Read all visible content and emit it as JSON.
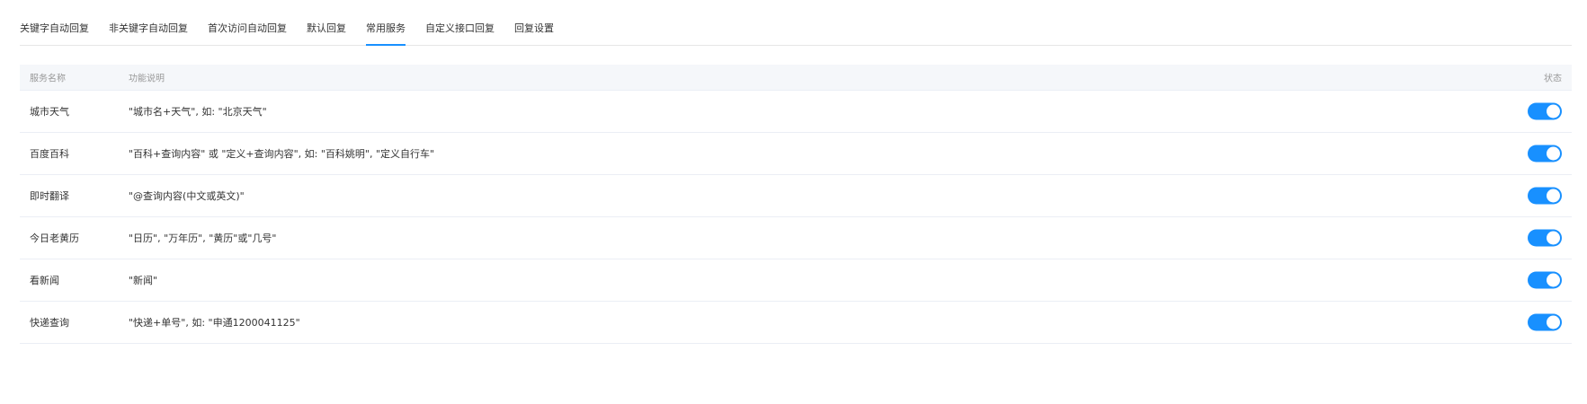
{
  "tabs": [
    {
      "label": "关键字自动回复"
    },
    {
      "label": "非关键字自动回复"
    },
    {
      "label": "首次访问自动回复"
    },
    {
      "label": "默认回复"
    },
    {
      "label": "常用服务"
    },
    {
      "label": "自定义接口回复"
    },
    {
      "label": "回复设置"
    }
  ],
  "active_tab": "常用服务",
  "table": {
    "headers": {
      "name": "服务名称",
      "desc": "功能说明",
      "status": "状态"
    },
    "rows": [
      {
        "name": "城市天气",
        "desc": "\"城市名+天气\", 如: \"北京天气\"",
        "enabled": true
      },
      {
        "name": "百度百科",
        "desc": "\"百科+查询内容\" 或 \"定义+查询内容\", 如: \"百科姚明\", \"定义自行车\"",
        "enabled": true
      },
      {
        "name": "即时翻译",
        "desc": "\"@查询内容(中文或英文)\"",
        "enabled": true
      },
      {
        "name": "今日老黄历",
        "desc": "\"日历\", \"万年历\", \"黄历\"或\"几号\"",
        "enabled": true
      },
      {
        "name": "看新闻",
        "desc": "\"新闻\"",
        "enabled": true
      },
      {
        "name": "快递查询",
        "desc": "\"快递+单号\", 如: \"申通1200041125\"",
        "enabled": true
      }
    ]
  },
  "colors": {
    "accent": "#1890ff",
    "header_bg": "#f5f7fa",
    "border": "#ebeef5"
  }
}
